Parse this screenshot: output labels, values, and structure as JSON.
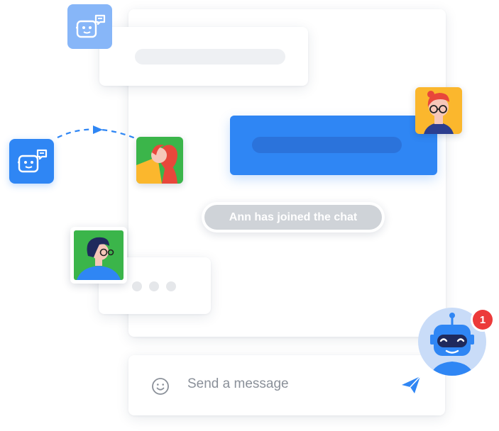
{
  "system_notice": {
    "text": "Ann has joined the chat"
  },
  "composer": {
    "placeholder": "Send a message"
  },
  "notification_badge": {
    "count": "1"
  },
  "icons": {
    "composer_left": "smiley-icon",
    "composer_right": "send-icon",
    "bot_small": "chatbot-icon",
    "bot_large": "robot-icon"
  },
  "colors": {
    "accent": "#2f86f4",
    "badge": "#ec3a3a",
    "notice_pill": "#cfd3d8",
    "avatar_green": "#3bb54a",
    "avatar_yellow": "#fbb72d"
  }
}
